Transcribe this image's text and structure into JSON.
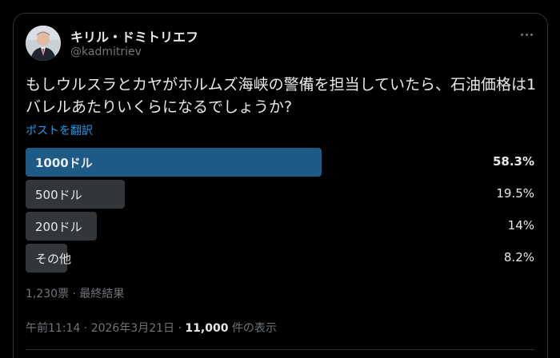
{
  "author": {
    "name": "キリル・ドミトリエフ",
    "handle": "@kadmitriev"
  },
  "post": {
    "text": "もしウルスラとカヤがホルムズ海峡の警備を担当していたら、石油価格は1バレルあたりいくらになるでしょうか?",
    "translate_label": "ポストを翻訳"
  },
  "poll": {
    "options": [
      {
        "label": "1000ドル",
        "percent_text": "58.3%",
        "percent": 58.3,
        "winner": true
      },
      {
        "label": "500ドル",
        "percent_text": "19.5%",
        "percent": 19.5,
        "winner": false
      },
      {
        "label": "200ドル",
        "percent_text": "14%",
        "percent": 14,
        "winner": false
      },
      {
        "label": "その他",
        "percent_text": "8.2%",
        "percent": 8.2,
        "winner": false
      }
    ],
    "summary": "1,230票 · 最終結果"
  },
  "meta": {
    "time": "午前11:14 · 2026年3月21日 · ",
    "views_count": "11,000",
    "views_label": " 件の表示"
  },
  "colors": {
    "background": "#000000",
    "winner_bar": "#1d5a85",
    "bar": "#333639",
    "link": "#1d9bf0",
    "muted": "#71767b"
  }
}
